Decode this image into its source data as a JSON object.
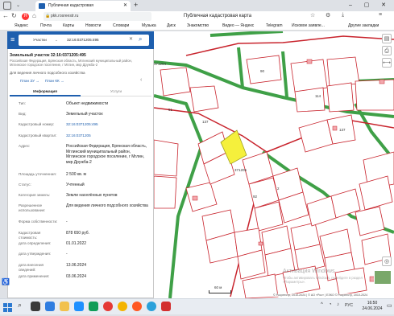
{
  "browser": {
    "tab_title": "Публичная кадастровая",
    "url": "pkk.rosreestr.ru",
    "page_title": "Публичная кадастровая карта",
    "bookmarks": [
      "Яндекс",
      "Почта",
      "Карты",
      "Новости",
      "Словари",
      "Музыка",
      "Диск",
      "Знакомство",
      "Видео — Яндекс",
      "Telegram",
      "Исковое заявле...",
      "Другие закладки"
    ]
  },
  "search": {
    "mode": "Участки",
    "query": "32:16:0371205:495"
  },
  "object": {
    "heading": "Земельный участок 32:16:0371205:495",
    "address_short": "Российская Федерация, Брянская область, Мглинский муниципальный район, Мглинское городское поселение, г Мглин, мкр Дружба-2",
    "use_short": "Для ведения личного подсобного хозяйства",
    "plan_link": "План ЗУ →",
    "plan_kk_link": "План КК →",
    "tabs": [
      "Информация",
      "Услуги"
    ],
    "fields": [
      {
        "k": "Тип:",
        "v": "Объект недвижимости"
      },
      {
        "k": "Вид:",
        "v": "Земельный участок"
      },
      {
        "k": "Кадастровый номер:",
        "v": "32:16:0371205:495"
      },
      {
        "k": "Кадастровый квартал:",
        "v": "32:16:0371205"
      },
      {
        "k": "Адрес:",
        "v": "Российская Федерация, Брянская область, Мглинский муниципальный район, Мглинское городское поселение, г Мглин, мкр Дружба-2"
      },
      {
        "k": "Площадь уточненная:",
        "v": "2 500 кв. м"
      },
      {
        "k": "Статус:",
        "v": "Учтенный"
      },
      {
        "k": "Категория земель:",
        "v": "Земли населённых пунктов"
      },
      {
        "k": "Разрешенное использование:",
        "v": "Для ведения личного подсобного хозяйства"
      },
      {
        "k": "Форма собственности:",
        "v": "-"
      },
      {
        "k": "Кадастровая стоимость:",
        "v": "878 650 руб."
      },
      {
        "k": "дата определения:",
        "v": "01.01.2022"
      },
      {
        "k": "дата утверждения:",
        "v": "-"
      },
      {
        "k": "дата внесения сведений:",
        "v": "13.06.2024"
      },
      {
        "k": "дата применения:",
        "v": "03.06.2024"
      }
    ]
  },
  "map": {
    "labels": [
      "371204",
      "371205",
      "114",
      "90",
      "51",
      "137",
      "2",
      "92",
      "137"
    ],
    "scale": "60 м",
    "attribution": "© Росреестр, 2010-2024 | © АО «Рос» | ЕЭКО © Росреестр, 2010-2024",
    "watermark_title": "Активация Windows",
    "watermark_sub": "Чтобы активировать Windows, перейдите в раздел «Параметры»."
  },
  "taskbar": {
    "lang": "РУС",
    "time": "16:50",
    "date": "24.06.2024"
  },
  "colors": {
    "accent": "#1e5fae",
    "highlight": "#f5f03c",
    "parcel_border": "#c8232c",
    "road": "#3fa047"
  }
}
